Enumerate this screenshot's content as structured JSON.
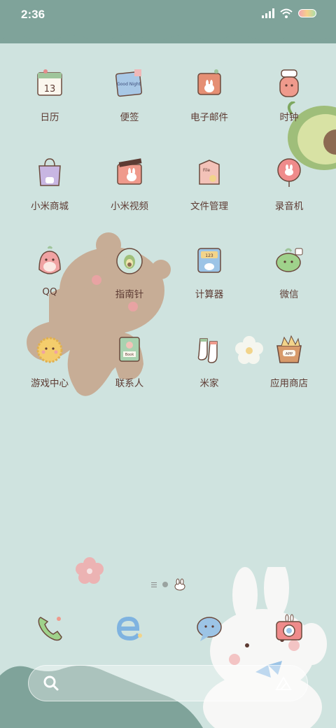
{
  "status_bar": {
    "time": "2:36"
  },
  "apps": [
    {
      "label": "日历",
      "icon": "calendar-icon",
      "badge": "13"
    },
    {
      "label": "便签",
      "icon": "notes-icon",
      "badge": "Good Night"
    },
    {
      "label": "电子邮件",
      "icon": "email-icon"
    },
    {
      "label": "时钟",
      "icon": "clock-icon"
    },
    {
      "label": "小米商城",
      "icon": "mi-store-icon"
    },
    {
      "label": "小米视频",
      "icon": "mi-video-icon"
    },
    {
      "label": "文件管理",
      "icon": "file-manager-icon",
      "badge": "File"
    },
    {
      "label": "录音机",
      "icon": "recorder-icon"
    },
    {
      "label": "QQ",
      "icon": "qq-icon"
    },
    {
      "label": "指南针",
      "icon": "compass-icon"
    },
    {
      "label": "计算器",
      "icon": "calculator-icon",
      "badge": "123"
    },
    {
      "label": "微信",
      "icon": "wechat-icon"
    },
    {
      "label": "游戏中心",
      "icon": "game-center-icon"
    },
    {
      "label": "联系人",
      "icon": "contacts-icon",
      "badge": "Book"
    },
    {
      "label": "米家",
      "icon": "mijia-icon"
    },
    {
      "label": "应用商店",
      "icon": "app-store-icon",
      "badge": "APP"
    }
  ],
  "dock": [
    {
      "icon": "phone-icon"
    },
    {
      "icon": "browser-icon"
    },
    {
      "icon": "messages-icon"
    },
    {
      "icon": "camera-icon"
    }
  ],
  "colors": {
    "background": "#cfe3df",
    "top_bar": "#7fa39a",
    "label": "#5d3b33"
  }
}
